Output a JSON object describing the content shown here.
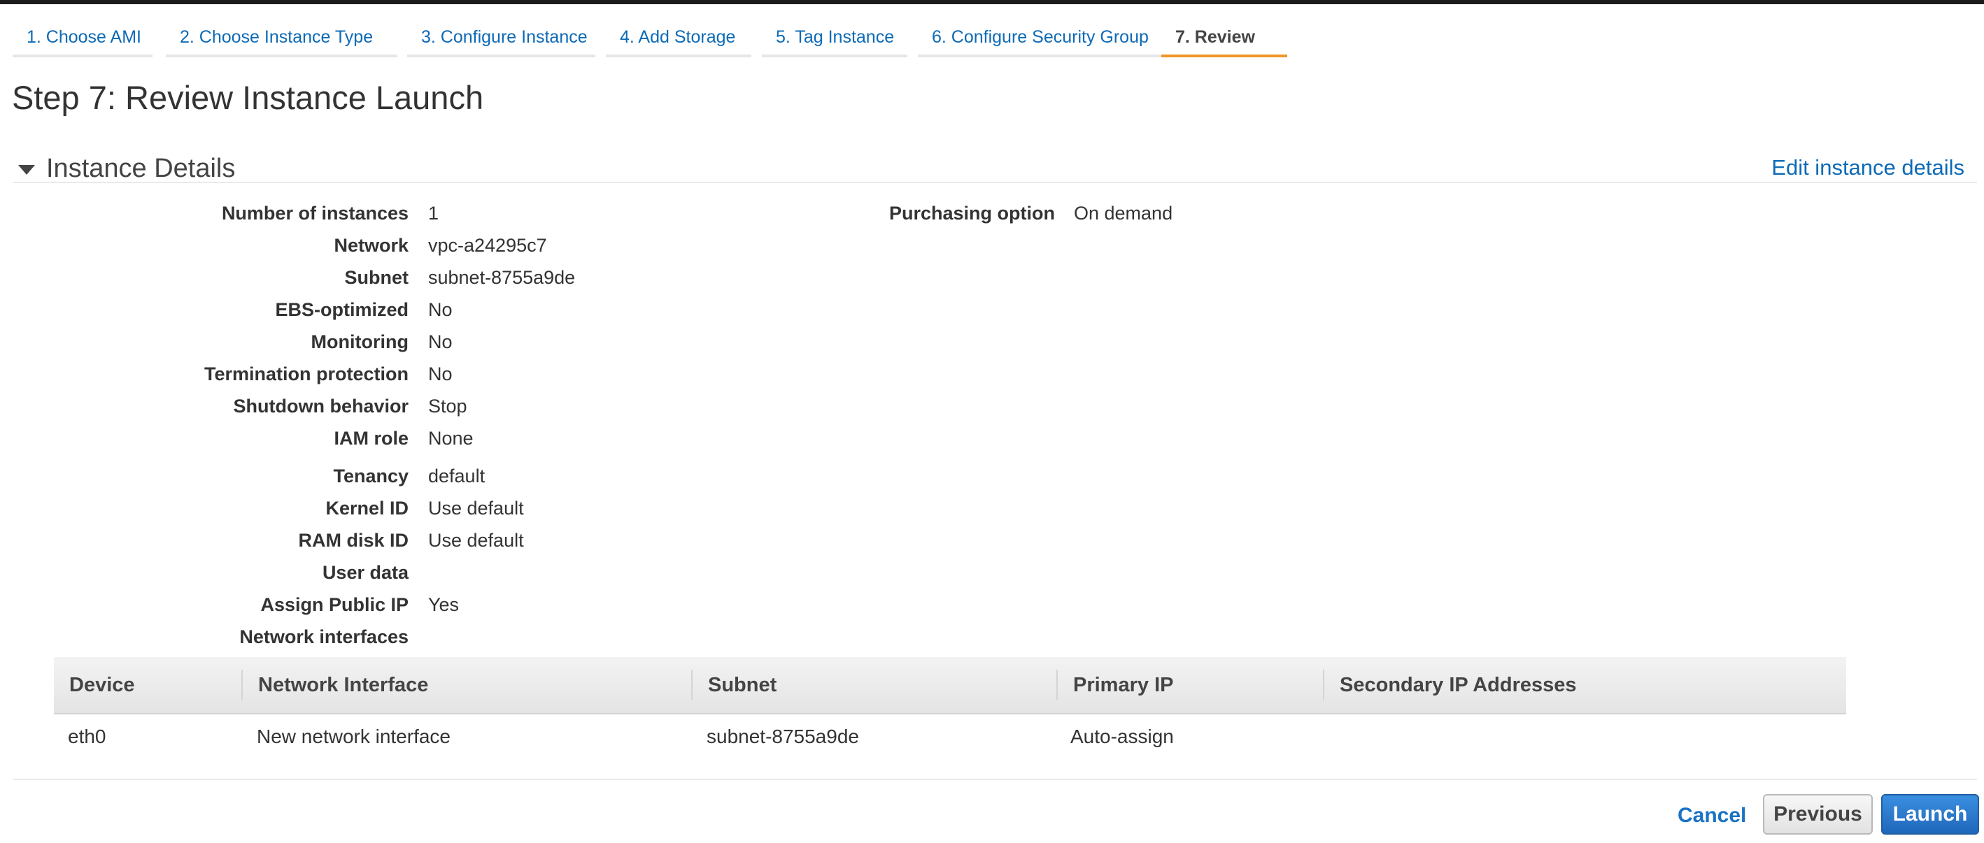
{
  "wizard": {
    "tabs": [
      {
        "label": "1. Choose AMI"
      },
      {
        "label": "2. Choose Instance Type"
      },
      {
        "label": "3. Configure Instance"
      },
      {
        "label": "4. Add Storage"
      },
      {
        "label": "5. Tag Instance"
      },
      {
        "label": "6. Configure Security Group"
      },
      {
        "label": "7. Review"
      }
    ],
    "active_tab": "7. Review"
  },
  "page_title": "Step 7: Review Instance Launch",
  "section": {
    "title": "Instance Details",
    "edit_link": "Edit instance details"
  },
  "details": [
    {
      "label": "Number of instances",
      "value": "1"
    },
    {
      "label": "Network",
      "value": "vpc-a24295c7"
    },
    {
      "label": "Subnet",
      "value": "subnet-8755a9de"
    },
    {
      "label": "EBS-optimized",
      "value": "No"
    },
    {
      "label": "Monitoring",
      "value": "No"
    },
    {
      "label": "Termination protection",
      "value": "No"
    },
    {
      "label": "Shutdown behavior",
      "value": "Stop"
    },
    {
      "label": "IAM role",
      "value": "None"
    },
    {
      "label": "Tenancy",
      "value": "default"
    },
    {
      "label": "Kernel ID",
      "value": "Use default"
    },
    {
      "label": "RAM disk ID",
      "value": "Use default"
    },
    {
      "label": "User data",
      "value": ""
    },
    {
      "label": "Assign Public IP",
      "value": "Yes"
    },
    {
      "label": "Network interfaces",
      "value": ""
    }
  ],
  "purchasing": {
    "label": "Purchasing option",
    "value": "On demand"
  },
  "network_interfaces": {
    "columns": [
      "Device",
      "Network Interface",
      "Subnet",
      "Primary IP",
      "Secondary IP Addresses"
    ],
    "rows": [
      {
        "device": "eth0",
        "network_interface": "New network interface",
        "subnet": "subnet-8755a9de",
        "primary_ip": "Auto-assign",
        "secondary_ip": ""
      }
    ]
  },
  "footer": {
    "cancel": "Cancel",
    "previous": "Previous",
    "launch": "Launch"
  },
  "colors": {
    "link": "#0d6ab6",
    "active_tab_underline": "#f0962a",
    "launch_button": "#2b7bd0"
  }
}
